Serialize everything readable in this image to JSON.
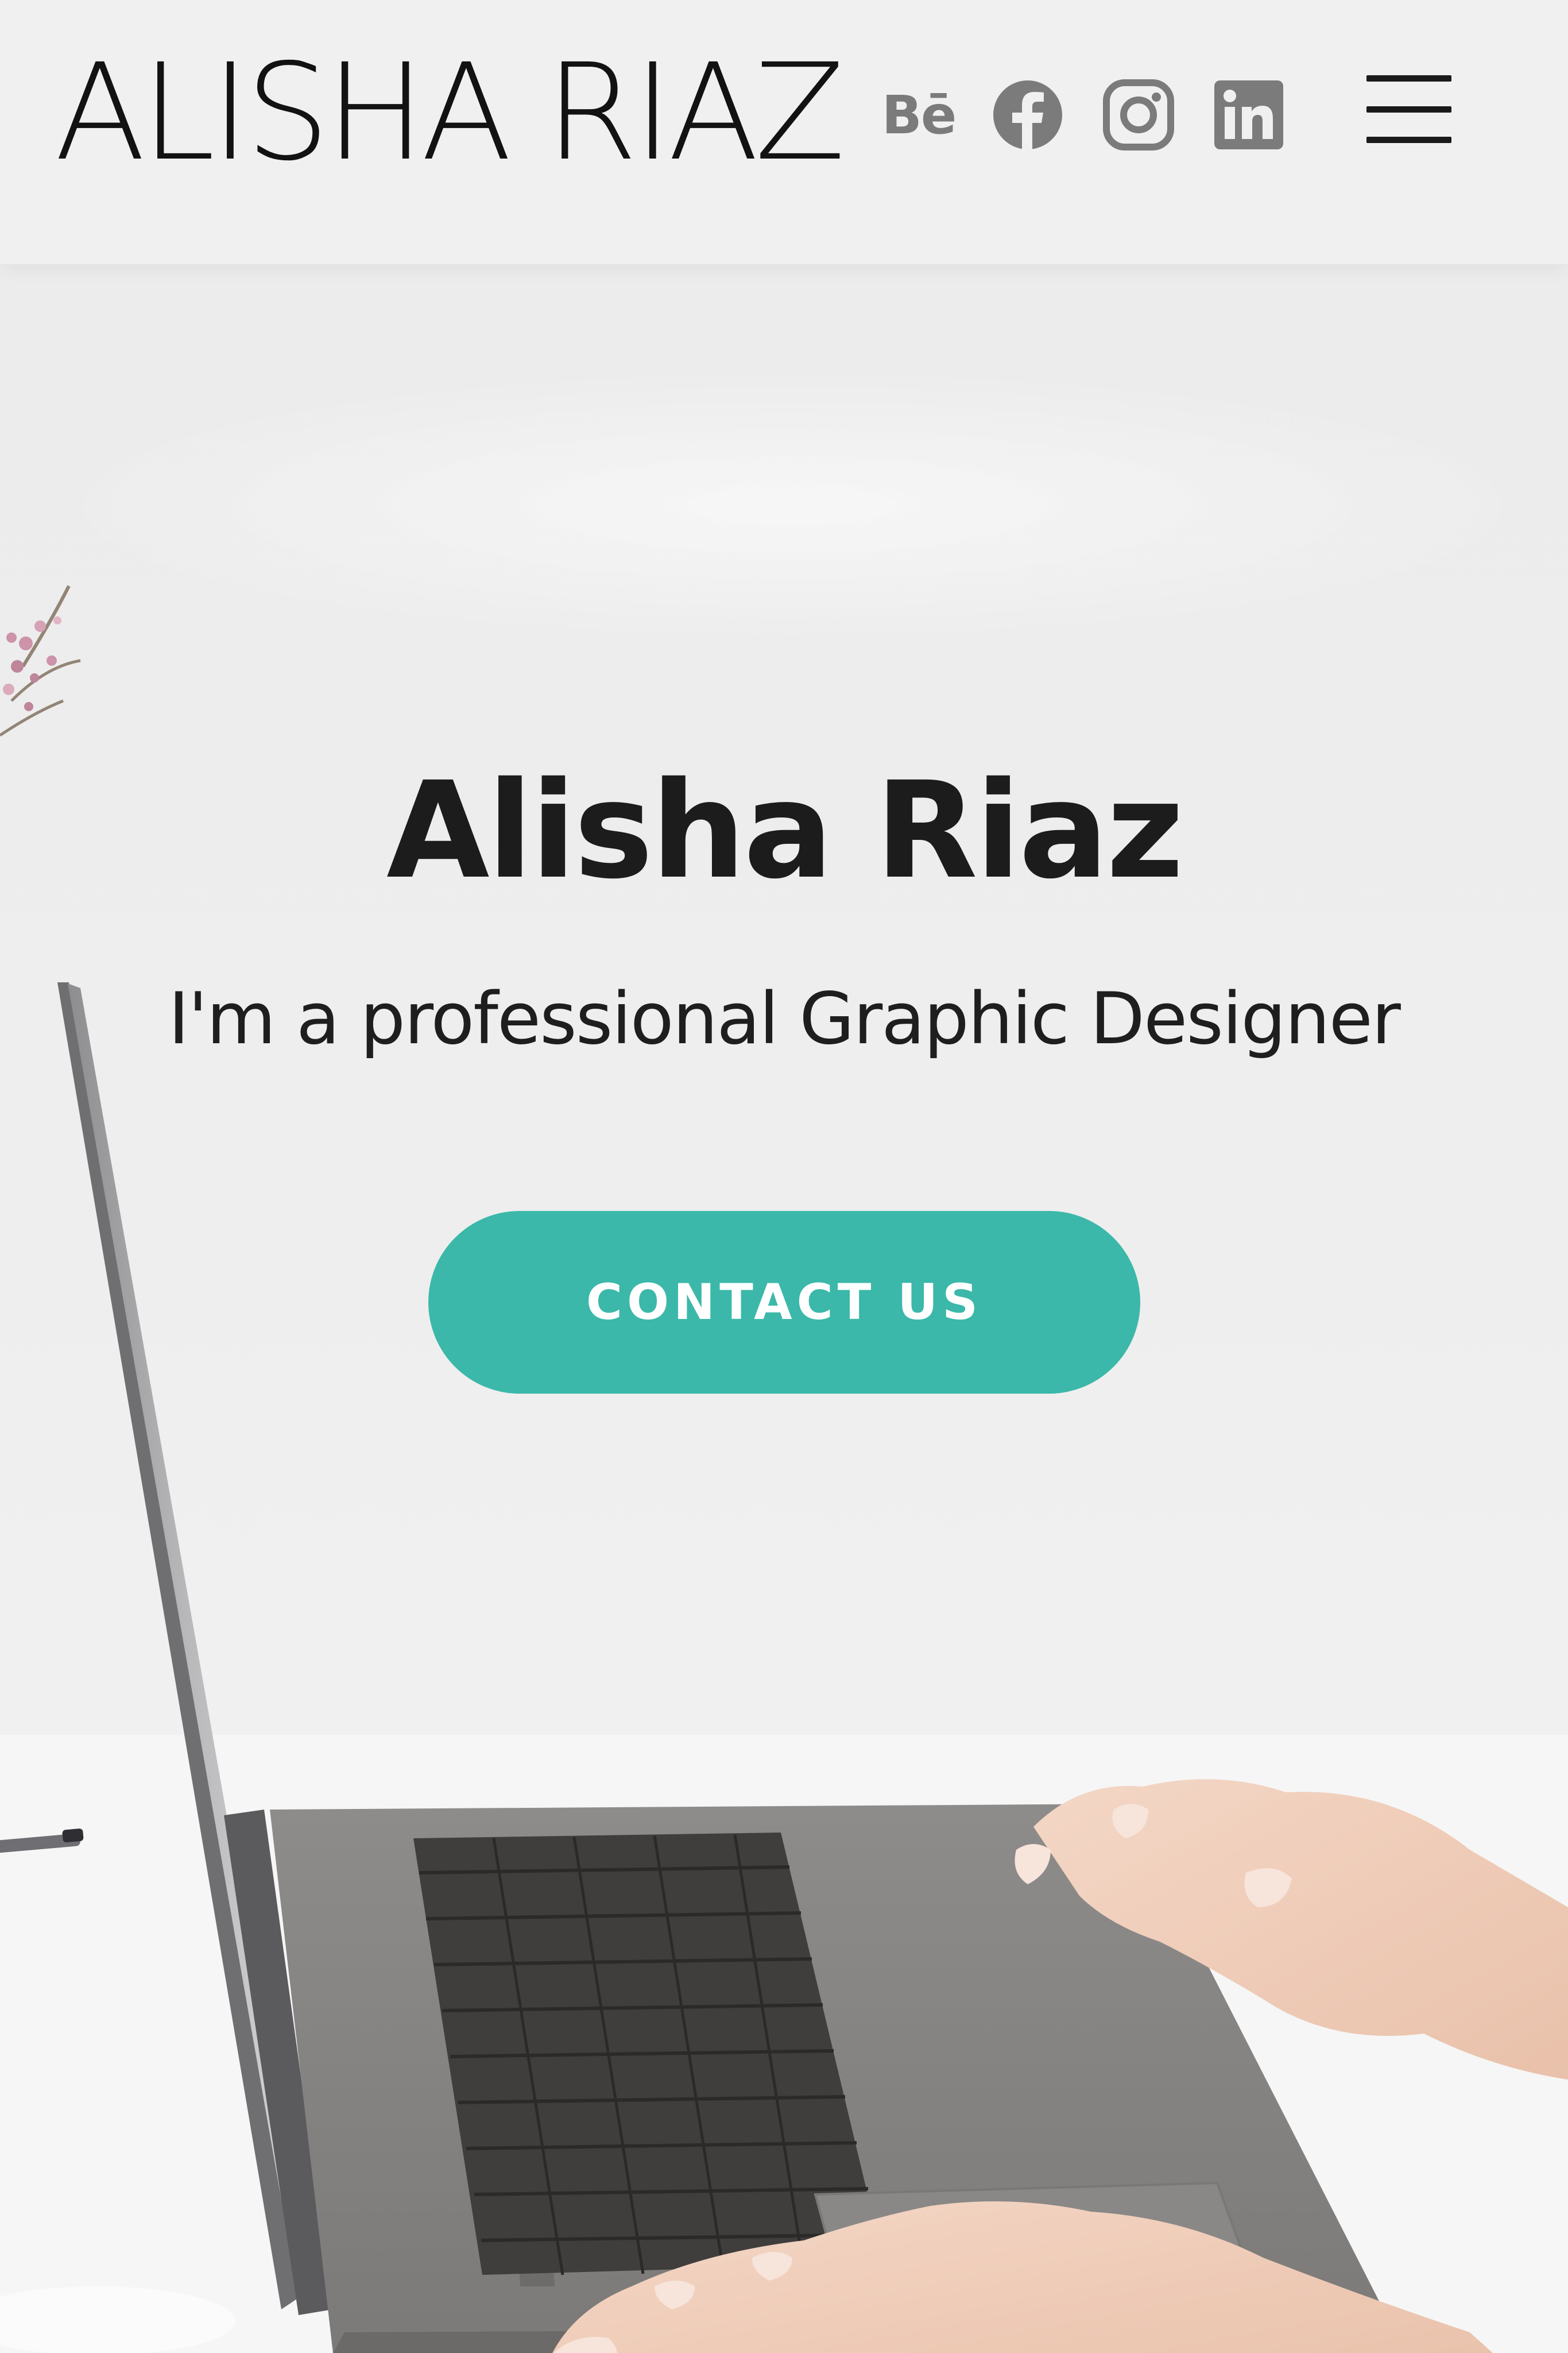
{
  "header": {
    "brand": "ALISHA RIAZ",
    "social": {
      "behance_label": "Bē",
      "behance_icon": "behance-icon",
      "facebook_icon": "facebook-icon",
      "instagram_icon": "instagram-icon",
      "linkedin_icon": "linkedin-icon"
    },
    "menu_icon": "hamburger-menu-icon"
  },
  "hero": {
    "title": "Alisha Riaz",
    "subtitle": "I'm a professional Graphic Designer",
    "cta_label": "CONTACT US",
    "background": "photo of hands typing on a laptop on a white desk"
  },
  "colors": {
    "accent": "#3bb8a9",
    "text_dark": "#1c1c1c",
    "icon_gray": "#7b7b7b",
    "background": "#eeeeee"
  }
}
